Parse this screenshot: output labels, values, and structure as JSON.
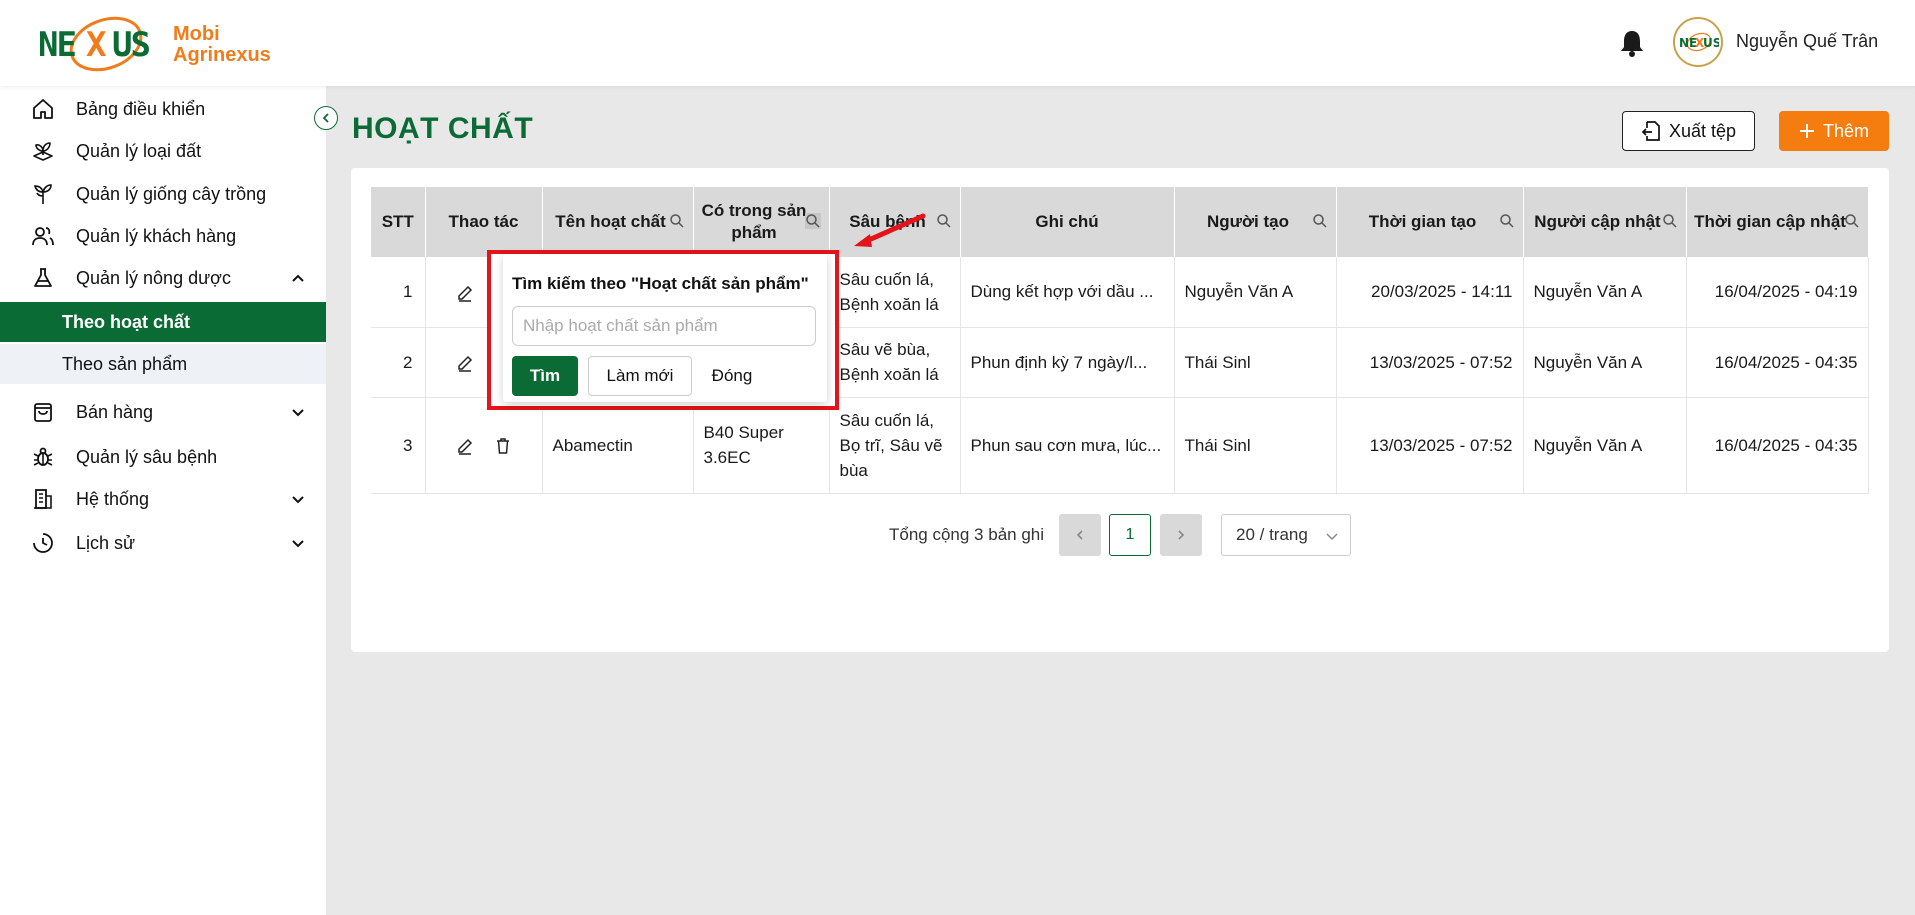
{
  "header": {
    "logo_text": "NEXUS",
    "brand_line1": "Mobi",
    "brand_line2": "Agrinexus",
    "user_name": "Nguyễn Quế Trân"
  },
  "sidebar": {
    "items": [
      {
        "label": "Bảng điều khiển",
        "icon": "home-icon"
      },
      {
        "label": "Quản lý loại đất",
        "icon": "soil-icon"
      },
      {
        "label": "Quản lý giống cây trồng",
        "icon": "plant-icon"
      },
      {
        "label": "Quản lý khách hàng",
        "icon": "users-icon"
      },
      {
        "label": "Quản lý nông dược",
        "icon": "flask-icon",
        "expanded": true
      },
      {
        "label": "Bán hàng",
        "icon": "bag-icon"
      },
      {
        "label": "Quản lý sâu bệnh",
        "icon": "bug-icon"
      },
      {
        "label": "Hệ thống",
        "icon": "building-icon"
      },
      {
        "label": "Lịch sử",
        "icon": "clock-icon"
      }
    ],
    "sub_items": [
      {
        "label": "Theo hoạt chất",
        "active": true
      },
      {
        "label": "Theo sản phẩm",
        "active": false
      }
    ]
  },
  "main": {
    "title": "HOẠT CHẤT",
    "export_label": "Xuất tệp",
    "add_label": "Thêm",
    "accent_color": "#0b6b35",
    "add_color": "#f57c0f"
  },
  "table": {
    "headers": [
      "STT",
      "Thao tác",
      "Tên hoạt chất",
      "Có trong sản phẩm",
      "Sâu bệnh",
      "Ghi chú",
      "Người tạo",
      "Thời gian tạo",
      "Người cập nhật",
      "Thời gian cập nhật"
    ],
    "rows": [
      {
        "stt": "1",
        "name": "",
        "product": "",
        "pest_line1": "Sâu cuốn lá,",
        "pest_line2": "Bệnh xoăn lá",
        "pest_line3": "",
        "note": "Dùng kết hợp với dầu ...",
        "creator": "Nguyễn Văn A",
        "created": "20/03/2025 - 14:11",
        "updater": "Nguyễn Văn A",
        "updated": "16/04/2025 - 04:19"
      },
      {
        "stt": "2",
        "name": "",
        "product": "",
        "pest_line1": "Sâu vẽ bùa,",
        "pest_line2": "Bệnh xoăn lá",
        "pest_line3": "",
        "note": "Phun định kỳ 7 ngày/l...",
        "creator": "Thái Sinl",
        "created": "13/03/2025 - 07:52",
        "updater": "Nguyễn Văn A",
        "updated": "16/04/2025 - 04:35"
      },
      {
        "stt": "3",
        "name": "Abamectin",
        "product_line1": "B40 Super",
        "product_line2": "3.6EC",
        "pest_line1": "Sâu cuốn lá,",
        "pest_line2": "Bọ trĩ, Sâu vẽ",
        "pest_line3": "bùa",
        "note": "Phun sau cơn mưa, lúc...",
        "creator": "Thái Sinl",
        "created": "13/03/2025 - 07:52",
        "updater": "Nguyễn Văn A",
        "updated": "16/04/2025 - 04:35"
      }
    ]
  },
  "pagination": {
    "total_label": "Tổng cộng 3 bản ghi",
    "current_page": "1",
    "page_size": "20 / trang",
    "prev": "<",
    "next": ">"
  },
  "search_popup": {
    "title": "Tìm kiếm theo \"Hoạt chất sản phẩm\"",
    "placeholder": "Nhập hoạt chất sản phẩm",
    "find_label": "Tìm",
    "reset_label": "Làm mới",
    "close_label": "Đóng",
    "highlight_color": "#e3141b"
  }
}
